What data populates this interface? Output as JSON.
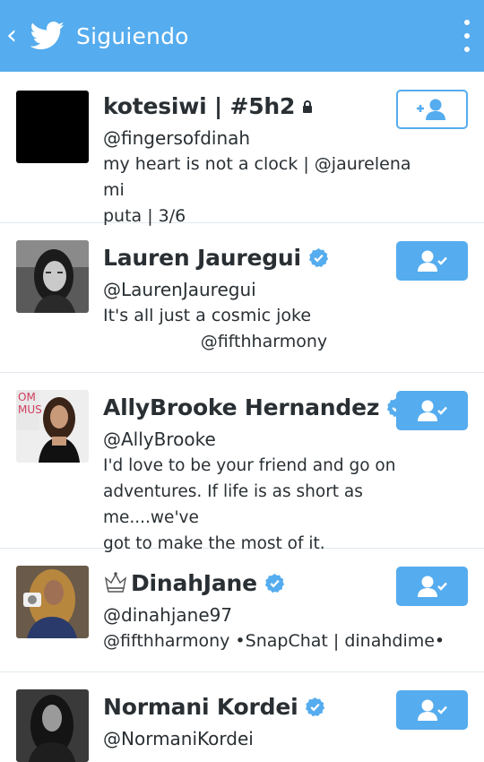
{
  "header": {
    "back_glyph": "‹",
    "title": "Siguiendo",
    "logo_icon": "twitter-bird-icon",
    "more_icon": "more-vertical-icon"
  },
  "colors": {
    "accent": "#55acee",
    "text": "#292f33",
    "divider": "#e1e8ed",
    "verified": "#55acee"
  },
  "users": [
    {
      "name": "kotesiwi | #5h2",
      "handle": "@fingersofdinah",
      "bio": "my heart is not a clock | @jaurelena mi\nputa | 3/6",
      "protected": true,
      "verified": false,
      "following": false,
      "button_icon": "follow-add-icon"
    },
    {
      "name": "Lauren Jauregui",
      "handle": "@LaurenJauregui",
      "bio": "It's all just a cosmic joke\n                  @fifthharmony",
      "protected": false,
      "verified": true,
      "following": true,
      "button_icon": "following-check-icon"
    },
    {
      "name": "AllyBrooke Hernandez",
      "handle": "@AllyBrooke",
      "bio": "I'd love to be your friend and go on\nadventures. If life is as short as me....we've\ngot to make the most of it.",
      "protected": false,
      "verified": true,
      "following": true,
      "button_icon": "following-check-icon"
    },
    {
      "name": "DinahJane",
      "name_prefix": "♕",
      "handle": "@dinahjane97",
      "bio": "@fifthharmony •SnapChat | dinahdime•",
      "protected": false,
      "verified": true,
      "following": true,
      "button_icon": "following-check-icon"
    },
    {
      "name": "Normani Kordei",
      "handle": "@NormaniKordei",
      "bio": "",
      "protected": false,
      "verified": true,
      "following": true,
      "button_icon": "following-check-icon"
    }
  ]
}
